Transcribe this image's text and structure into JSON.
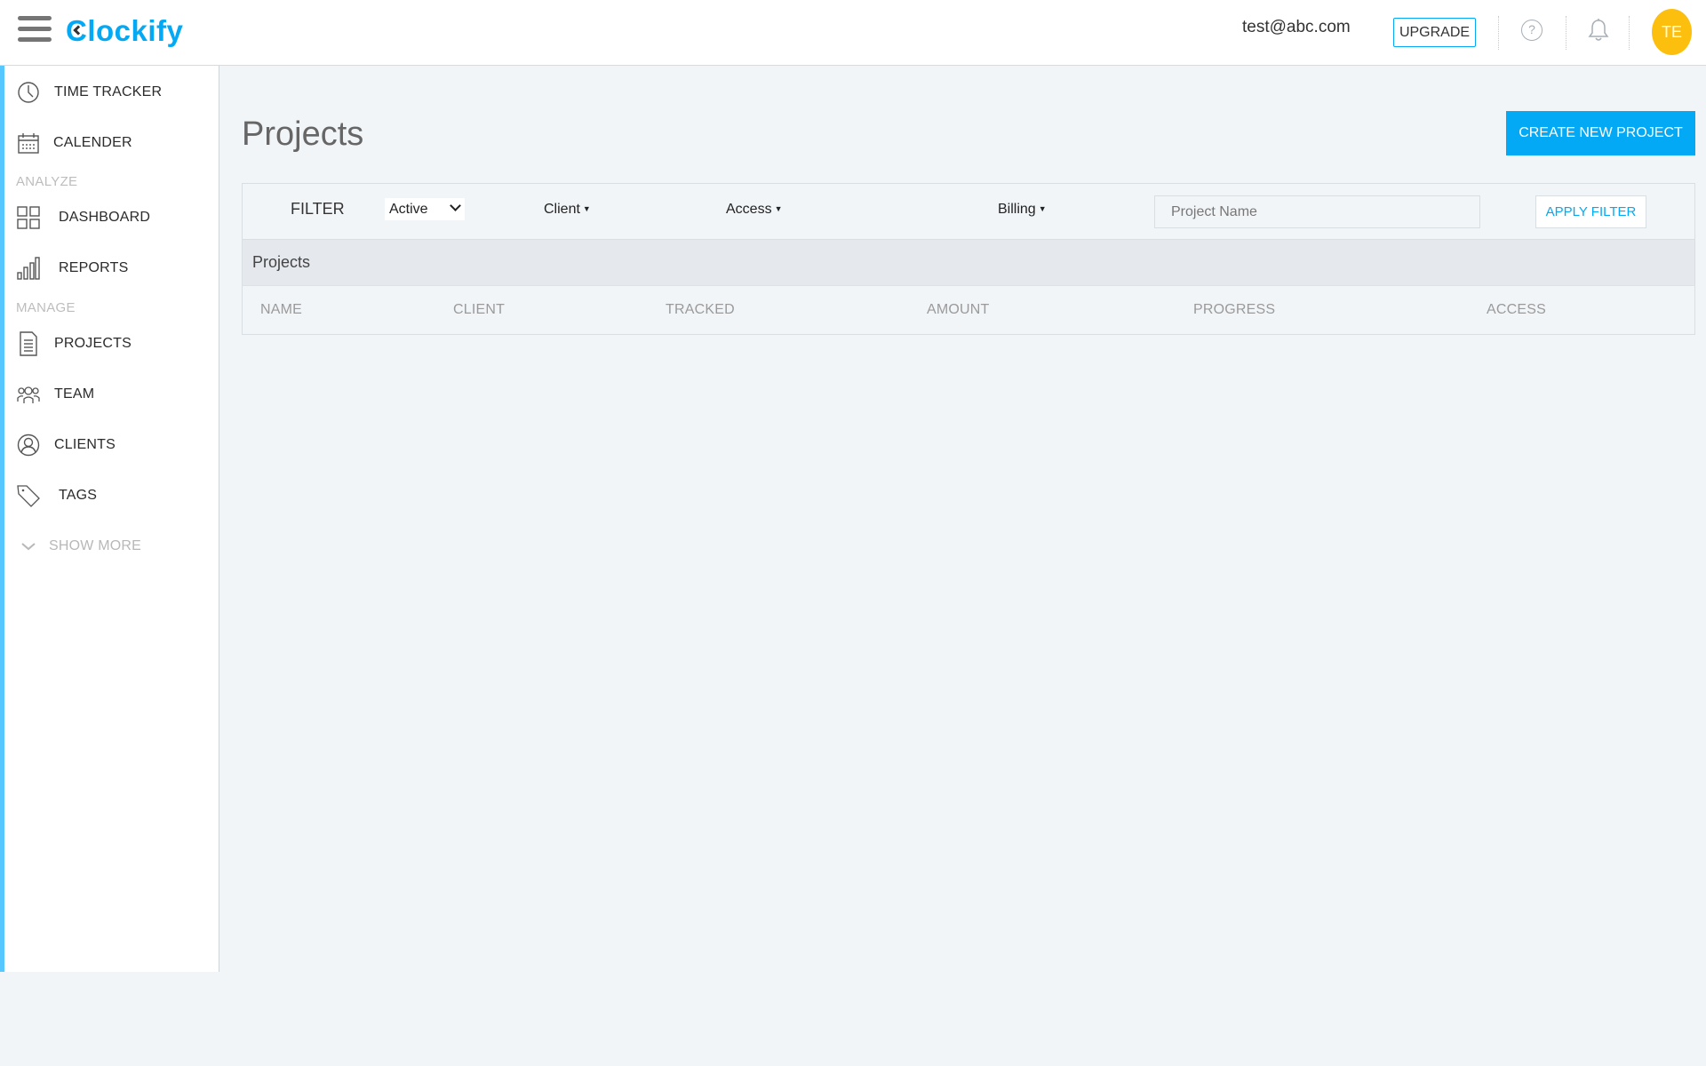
{
  "app": {
    "name": "Clockify",
    "brand_color": "#03a9f4",
    "accent_stripe_color": "#56c7ff"
  },
  "header": {
    "menu_icon": "hamburger-menu-icon",
    "user_email": "test@abc.com",
    "upgrade_label": "UPGRADE",
    "help_icon": "question-circle-icon",
    "help_glyph": "?",
    "notifications_icon": "bell-icon",
    "avatar_initials": "TE",
    "avatar_color": "#fdbf0e"
  },
  "sidebar": {
    "items": [
      {
        "label": "TIME TRACKER",
        "icon": "clock-icon"
      },
      {
        "label": "CALENDER",
        "icon": "calendar-icon"
      },
      {
        "label": "DASHBOARD",
        "icon": "dashboard-grid-icon"
      },
      {
        "label": "REPORTS",
        "icon": "bar-chart-icon"
      },
      {
        "label": "PROJECTS",
        "icon": "document-icon"
      },
      {
        "label": "TEAM",
        "icon": "team-icon"
      },
      {
        "label": "CLIENTS",
        "icon": "user-circle-icon"
      },
      {
        "label": "TAGS",
        "icon": "tag-icon"
      }
    ],
    "sections": {
      "analyze": "ANALYZE",
      "manage": "MANAGE"
    },
    "show_more_label": "SHOW MORE",
    "show_more_icon": "chevron-down-icon"
  },
  "main": {
    "page_title": "Projects",
    "create_button_label": "CREATE NEW PROJECT",
    "filter": {
      "label": "FILTER",
      "status_selected": "Active",
      "client_label": "Client",
      "access_label": "Access",
      "billing_label": "Billing",
      "caret_glyph": "▼",
      "name_placeholder": "Project Name",
      "name_value": "",
      "apply_label": "APPLY FILTER"
    },
    "section_title": "Projects",
    "columns": [
      "NAME",
      "CLIENT",
      "TRACKED",
      "AMOUNT",
      "PROGRESS",
      "ACCESS"
    ],
    "rows": []
  }
}
